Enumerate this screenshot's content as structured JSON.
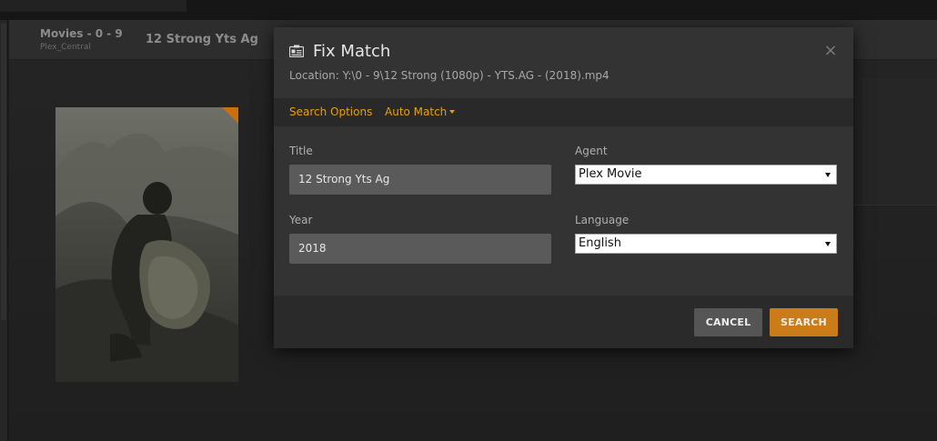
{
  "background": {
    "library_title": "Movies - 0 - 9",
    "server_name": "Plex_Central",
    "movie_title": "12 Strong Yts Ag"
  },
  "modal": {
    "icon": "id-card-icon",
    "title": "Fix Match",
    "location": "Location: Y:\\0 - 9\\12 Strong (1080p) - YTS.AG - (2018).mp4",
    "close_glyph": "×",
    "tabs": [
      {
        "label": "Search Options"
      },
      {
        "label": "Auto Match"
      }
    ],
    "fields": {
      "title_label": "Title",
      "title_value": "12 Strong Yts Ag",
      "year_label": "Year",
      "year_value": "2018",
      "agent_label": "Agent",
      "agent_value": "Plex Movie",
      "language_label": "Language",
      "language_value": "English"
    },
    "buttons": {
      "cancel": "CANCEL",
      "search": "SEARCH"
    }
  },
  "colors": {
    "accent": "#e5a00d",
    "search_button": "#cc7b19",
    "cancel_button": "#555555",
    "modal_bg": "#333333"
  }
}
